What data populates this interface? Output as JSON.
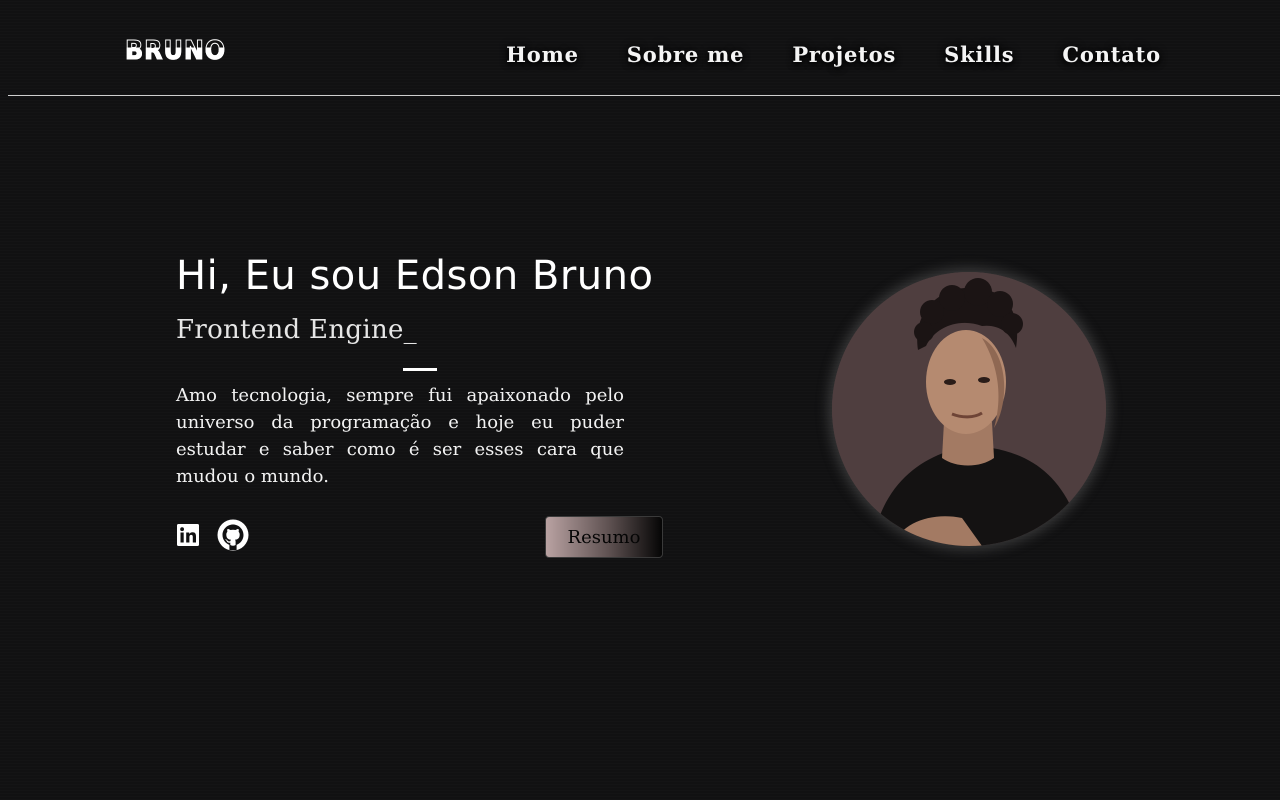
{
  "header": {
    "logo": "BRUNO",
    "nav": [
      "Home",
      "Sobre me",
      "Projetos",
      "Skills",
      "Contato"
    ]
  },
  "hero": {
    "title": "Hi, Eu sou Edson Bruno",
    "subtitle": "Frontend Engine_",
    "description": "Amo tecnologia, sempre fui apaixonado pelo universo da programação e hoje eu puder estudar e saber como é ser esses cara que mudou o mundo.",
    "resume_label": "Resumo",
    "social_icons": [
      "linkedin-icon",
      "github-icon"
    ]
  },
  "colors": {
    "background": "#111112",
    "text": "#f2f2f2",
    "photo_background": "#4f3e3f"
  }
}
